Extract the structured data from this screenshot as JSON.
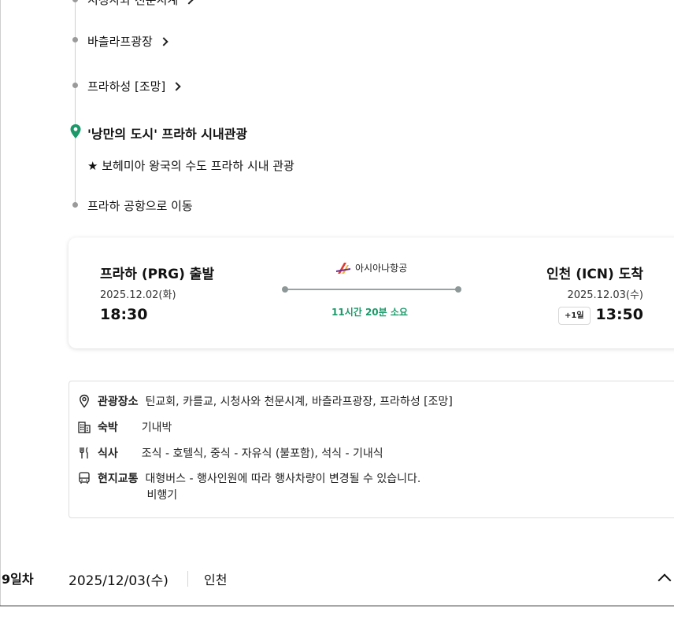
{
  "timeline": {
    "top_clipped": "시청사와 천문시계",
    "items": [
      {
        "label": "바츨라프광장"
      },
      {
        "label": "프라하성 [조망]"
      },
      {
        "label": "'낭만의 도시' 프라하 시내관광"
      },
      {
        "label": "★ 보헤미아 왕국의 수도 프라하 시내 관광"
      },
      {
        "label": "프라하 공항으로 이동"
      }
    ],
    "pin_color": "#1a9a6a"
  },
  "flight": {
    "departure_title": "프라하 (PRG) 출발",
    "departure_date": "2025.12.02(화)",
    "departure_time": "18:30",
    "airline": "아시아나항공",
    "duration": "11시간 20분 소요",
    "arrival_title": "인천 (ICN) 도착",
    "arrival_date": "2025.12.03(수)",
    "arrival_time": "13:50",
    "plus_day": "+1일",
    "accent_color": "#1a9a6a"
  },
  "info": {
    "sights_label": "관광장소",
    "sights_value": "틴교회, 카를교, 시청사와 천문시계, 바츨라프광장, 프라하성 [조망]",
    "lodging_label": "숙박",
    "lodging_value": "기내박",
    "meals_label": "식사",
    "meals_value": "조식 - 호텔식, 중식 - 자유식 (불포함), 석식 - 기내식",
    "transport_label": "현지교통",
    "transport_value_1": "대형버스 - 행사인원에 따라 행사차량이 변경될 수 있습니다.",
    "transport_value_2": "비행기"
  },
  "day": {
    "label": "9일차",
    "date": "2025/12/03(수)",
    "city": "인천"
  }
}
